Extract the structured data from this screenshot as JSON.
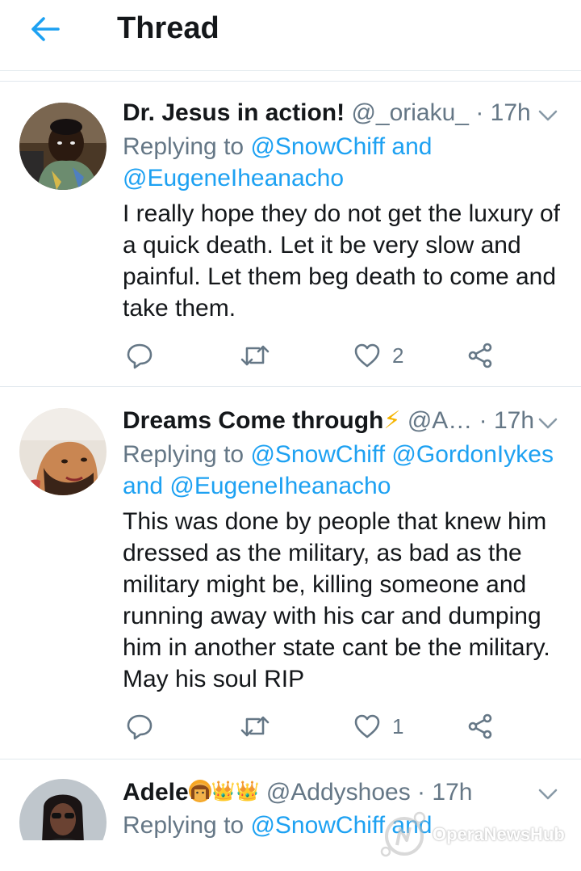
{
  "header": {
    "title": "Thread"
  },
  "tweets": [
    {
      "name": "Dr. Jesus in action!",
      "name_emoji": "",
      "handle": "@_oriaku_",
      "dot": "·",
      "time": "17h",
      "reply_prefix": "Replying to ",
      "reply_line1_mentions": "@SnowChiff and",
      "reply_line2_mentions": "@EugeneIheanacho",
      "body": "I really hope they do not get the luxury of\na quick death. Let it be very slow and\npainful. Let them beg death to come and\ntake them.",
      "reply_count": "",
      "retweet_count": "",
      "like_count": "2"
    },
    {
      "name": "Dreams Come through",
      "name_emoji": "⚡",
      "handle": "@A…",
      "dot": "·",
      "time": "17h",
      "reply_prefix": "Replying to ",
      "reply_line1_mentions": "@SnowChiff @GordonIykes",
      "reply_line2_mentions": "and @EugeneIheanacho",
      "body": "This was done by people that knew him\ndressed as the military, as bad as the\nmilitary might be, killing someone and\nrunning away with his car and dumping\nhim in another state cant be the military.\nMay his soul RIP",
      "reply_count": "",
      "retweet_count": "",
      "like_count": "1"
    },
    {
      "name": "Adele",
      "name_emoji": "👑👑",
      "handle": "@Addyshoes",
      "dot": "·",
      "time": "17h",
      "reply_prefix": "Replying to ",
      "reply_line1_mentions": "@SnowChiff and"
    }
  ],
  "watermark": {
    "text": "OperaNewsHub"
  },
  "colors": {
    "accent": "#1da1f2",
    "muted": "#657786",
    "text": "#14171a",
    "divider": "#e1e8ed"
  },
  "icons": [
    "back-arrow-icon",
    "chevron-down-icon",
    "reply-icon",
    "retweet-icon",
    "like-heart-icon",
    "share-icon"
  ]
}
